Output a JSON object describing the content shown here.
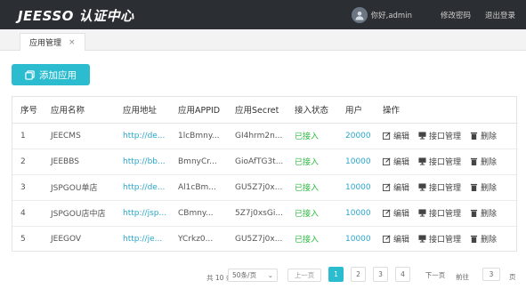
{
  "header": {
    "brand": "JEESSO 认证中心",
    "greeting": "你好,admin",
    "change_password": "修改密码",
    "logout": "退出登录"
  },
  "tabs": [
    {
      "label": "应用管理",
      "close": "×"
    }
  ],
  "toolbar": {
    "add_label": "添加应用"
  },
  "table": {
    "columns": [
      "序号",
      "应用名称",
      "应用地址",
      "应用APPID",
      "应用Secret",
      "接入状态",
      "用户",
      "操作"
    ],
    "rows": [
      {
        "no": "1",
        "name": "JEECMS",
        "url": "http://de...",
        "appid": "1lcBmny...",
        "secret": "GI4hrm2n...",
        "status": "已接入",
        "users": "20000"
      },
      {
        "no": "2",
        "name": "JEEBBS",
        "url": "http://bb...",
        "appid": "BmnyCr...",
        "secret": "GioAfTG3t...",
        "status": "已接入",
        "users": "10000"
      },
      {
        "no": "3",
        "name": "JSPGOU单店",
        "url": "http://de...",
        "appid": "Al1cBm...",
        "secret": "GU5Z7j0x...",
        "status": "已接入",
        "users": "10000"
      },
      {
        "no": "4",
        "name": "JSPGOU店中店",
        "url": "http://jsp...",
        "appid": "CBmny...",
        "secret": "5Z7j0xsGi...",
        "status": "已接入",
        "users": "10000"
      },
      {
        "no": "5",
        "name": "JEEGOV",
        "url": "http://je...",
        "appid": "YCrkz0...",
        "secret": "GU5Z7j0x...",
        "status": "已接入",
        "users": "10000"
      }
    ],
    "actions": {
      "edit": "编辑",
      "api": "接口管理",
      "delete": "删除"
    }
  },
  "pager": {
    "total": "共 10 条",
    "page_size": "50条/页",
    "prev": "上一页",
    "pages": [
      "1",
      "2",
      "3",
      "4"
    ],
    "current": "1",
    "next": "下一页",
    "goto": "前往",
    "goto_value": "3",
    "unit": "页"
  },
  "colors": {
    "accent": "#2bbcd0",
    "topbar": "#2b2f33",
    "link": "#2aa6c8",
    "success": "#2dbb42"
  },
  "icons": [
    "user-avatar-icon",
    "add-icon",
    "edit-icon",
    "api-icon",
    "trash-icon",
    "chevron-down-icon"
  ]
}
